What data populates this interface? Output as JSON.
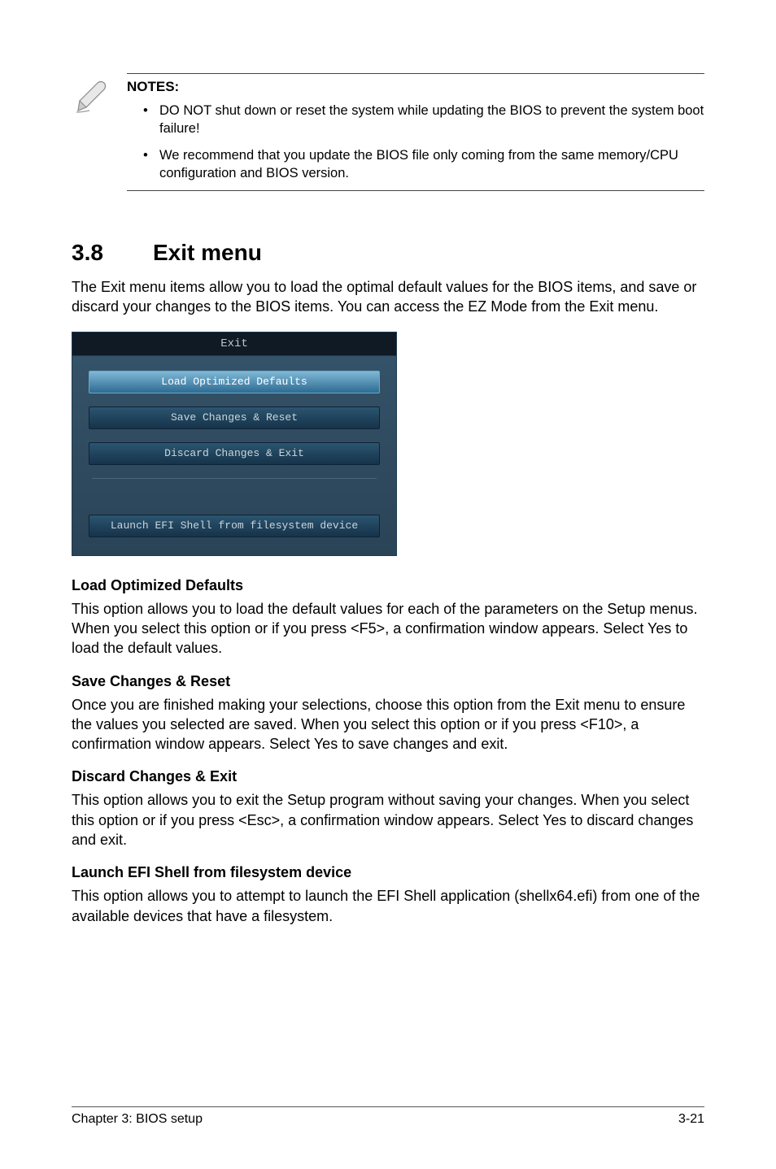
{
  "notes": {
    "heading": "NOTES:",
    "items": [
      "DO NOT shut down or reset the system while updating the BIOS to prevent the system boot failure!",
      "We recommend that you update the BIOS file only coming from the same memory/CPU configuration and BIOS version."
    ]
  },
  "section": {
    "number": "3.8",
    "title": "Exit menu",
    "intro": "The Exit menu items allow you to load the optimal default values for the BIOS items, and save or discard your changes to the BIOS items. You can access the EZ Mode from the Exit menu."
  },
  "dialog": {
    "title": "Exit",
    "buttons": {
      "load": "Load Optimized Defaults",
      "save": "Save Changes & Reset",
      "discard": "Discard Changes & Exit",
      "launch": "Launch EFI Shell from filesystem device"
    }
  },
  "descriptions": {
    "load_h": "Load Optimized Defaults",
    "load_p": "This option allows you to load the default values for each of the parameters on the Setup menus. When you select this option or if you press <F5>, a confirmation window appears. Select Yes to load the default values.",
    "save_h": "Save Changes & Reset",
    "save_p": "Once you are finished making your selections, choose this option from the Exit menu to ensure the values you selected are saved. When you select this option or if you press <F10>, a confirmation window appears. Select Yes to save changes and exit.",
    "discard_h": "Discard Changes & Exit",
    "discard_p": "This option allows you to exit the Setup program without saving your changes. When you select this option or if you press <Esc>, a confirmation window appears. Select Yes to discard changes and exit.",
    "launch_h": "Launch EFI Shell from filesystem device",
    "launch_p": "This option allows you to attempt to launch the EFI Shell application (shellx64.efi) from one of the available devices that have a filesystem."
  },
  "footer": {
    "chapter": "Chapter 3: BIOS setup",
    "page": "3-21"
  }
}
